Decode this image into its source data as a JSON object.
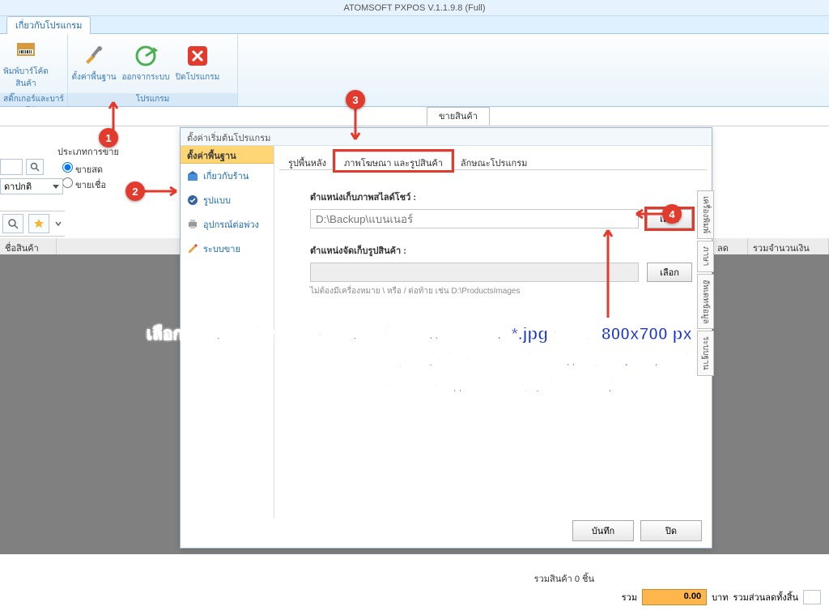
{
  "app_title": "ATOMSOFT PXPOS V.1.1.9.8 (Full)",
  "ribbon_tab": "เกี่ยวกับโปรแกรม",
  "ribbon": {
    "g1_label": "สติ๊กเกอร์และบาร์โค้ด",
    "g1_btn1": "พิมพ์บาร์โค้ดสินค้า",
    "g2_label": "โปรแกรม",
    "g2_btn1": "ตั้งค่าพื้นฐาน",
    "g2_btn2": "ออกจากระบบ",
    "g2_btn3": "ปิดโปรแกรม"
  },
  "sell_tab": "ขายสินค้า",
  "sale": {
    "hdr": "ประเภทการขาย",
    "opt1": "ขายสด",
    "opt2": "ขายเชื่อ",
    "dd": "ดาปกติ"
  },
  "table": {
    "c1": "ชื่อสินค้า",
    "c2": "ลด",
    "c3": "รวมจำนวนเงิน"
  },
  "footer": {
    "items": "รวมสินค้า 0  ชิ้น",
    "sum_lbl": "รวม",
    "amount": "0.00",
    "baht": "บาท",
    "disc_lbl": "รวมส่วนลดทั้งสิ้น"
  },
  "dialog": {
    "title": "ตั้งค่าเริ่มต้นโปรแกรม",
    "side_hdr": "ตั้งค่าพื้นฐาน",
    "s1": "เกี่ยวกับร้าน",
    "s2": "รูปแบบ",
    "s3": "อุปกรณ์ต่อพ่วง",
    "s4": "ระบบขาย",
    "tab1": "รูปพื้นหลัง",
    "tab2": "ภาพโฆษณา และรูปสินค้า",
    "tab3": "ลักษณะโปรแกรม",
    "lbl1": "ตำแหน่งเก็บภาพสไลด์โชว์ :",
    "path1": "D:\\Backup\\แบนเนอร์",
    "pick": "เลือก",
    "lbl2": "ตำแหน่งจัดเก็บรูปสินค้า :",
    "hint": "ไม่ต้องมีเครื่องหมาย \\ หรือ / ต่อท้าย เช่น D:\\ProductsImages",
    "save": "บันทึก",
    "close": "ปิด",
    "vt1": "เครื่องพิมพ์",
    "vt2": "ภาษา",
    "vt3": "อัพเดทข้อมูล",
    "vt4": "ระบบฐาน"
  },
  "help": {
    "l1": "เลือกตำแหน่งเก็บรูปโฆษณาหน้าร้าน ไฟล์ประเภท *.jpg ขนาด 800x700 px",
    "l2": "โดยให้เก็บรวมกันไว้ในโฟลเดอร์ที่ตั้งค่าไว้",
    "l3": "ระบบจะอ่านรายการไฟล์ตอนเปิดหน้าจอลูกค้าอัตโนมัติ"
  }
}
